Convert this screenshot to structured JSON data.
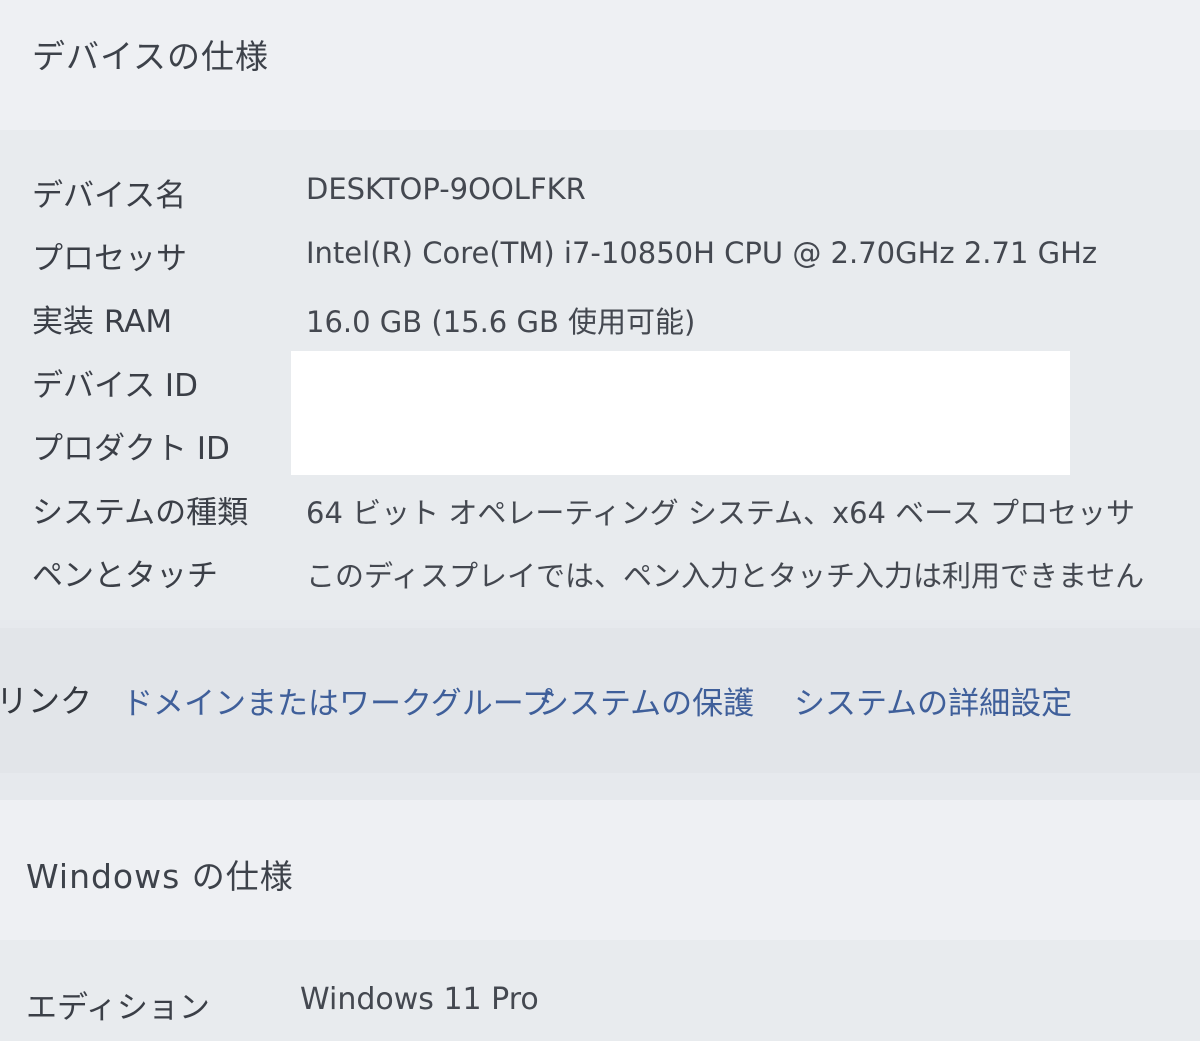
{
  "device_spec": {
    "title": "デバイスの仕様",
    "rows": [
      {
        "label": "デバイス名",
        "value": "DESKTOP-9OOLFKR"
      },
      {
        "label": "プロセッサ",
        "value": "Intel(R) Core(TM) i7-10850H CPU @ 2.70GHz   2.71 GHz"
      },
      {
        "label": "実装 RAM",
        "value": "16.0 GB (15.6 GB 使用可能)"
      },
      {
        "label": "デバイス ID",
        "value": ""
      },
      {
        "label": "プロダクト ID",
        "value": ""
      },
      {
        "label": "システムの種類",
        "value": "64 ビット オペレーティング システム、x64 ベース プロセッサ"
      },
      {
        "label": "ペンとタッチ",
        "value": "このディスプレイでは、ペン入力とタッチ入力は利用できません"
      }
    ]
  },
  "related_links": {
    "heading": "リンク",
    "domain_workgroup": "ドメインまたはワークグループ",
    "system_protection": "システムの保護",
    "advanced_settings": "システムの詳細設定"
  },
  "windows_spec": {
    "title": "Windows の仕様",
    "rows": [
      {
        "label": "エディション",
        "value": "Windows 11 Pro"
      }
    ]
  },
  "colors": {
    "link": "#3f5f9a",
    "background": "#e6e9ed",
    "redaction": "#ffffff"
  }
}
